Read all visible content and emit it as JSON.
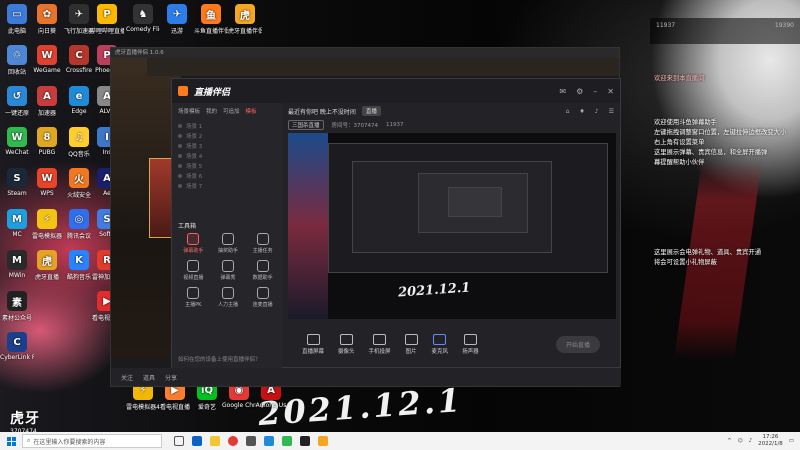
{
  "desktop": {
    "icons": [
      {
        "label": "此电脑",
        "color": "#3d7bd8",
        "glyph": "▭"
      },
      {
        "label": "向日葵",
        "color": "#e8742a",
        "glyph": "✿"
      },
      {
        "label": "飞行加速器",
        "color": "#2f2f2f",
        "glyph": "✈"
      },
      {
        "label": "哔哩哔哩直播",
        "color": "#ffb800",
        "glyph": "P"
      },
      {
        "label": "Comedy Flight",
        "color": "#333",
        "glyph": "♞"
      },
      {
        "label": "迅游",
        "color": "#2b7de9",
        "glyph": "✈"
      },
      {
        "label": "斗鱼直播伴侣",
        "color": "#ff7a1a",
        "glyph": "鱼"
      },
      {
        "label": "虎牙直播伴侣",
        "color": "#f5a623",
        "glyph": "虎"
      },
      {
        "label": "回收站",
        "color": "#4c88d6",
        "glyph": "♲"
      },
      {
        "label": "WeGame",
        "color": "#e0402f",
        "glyph": "W"
      },
      {
        "label": "Crossfire",
        "color": "#b5362b",
        "glyph": "C"
      },
      {
        "label": "Phoenix",
        "color": "#bb3f5a",
        "glyph": "P"
      },
      {
        "label": "一键还原",
        "color": "#2a89d6",
        "glyph": "↺"
      },
      {
        "label": "加速器",
        "color": "#c63d3d",
        "glyph": "A"
      },
      {
        "label": "Edge",
        "color": "#1f8bd8",
        "glyph": "e"
      },
      {
        "label": "ALVR",
        "color": "#888",
        "glyph": "A"
      },
      {
        "label": "WeChat",
        "color": "#2fb94f",
        "glyph": "W"
      },
      {
        "label": "Ins",
        "color": "#3f77c8",
        "glyph": "I"
      },
      {
        "label": "Steam",
        "color": "#1b2838",
        "glyph": "S"
      },
      {
        "label": "PUBG",
        "color": "#e0a820",
        "glyph": "8"
      },
      {
        "label": "QQ音乐",
        "color": "#ffce2e",
        "glyph": "♫"
      },
      {
        "label": "Ae",
        "color": "#1a1e6e",
        "glyph": "A"
      },
      {
        "label": "MC",
        "color": "#1ea0e0",
        "glyph": "M"
      },
      {
        "label": "WPS",
        "color": "#e8442a",
        "glyph": "W"
      },
      {
        "label": "火绒安全",
        "color": "#f07820",
        "glyph": "火"
      },
      {
        "label": "MWin",
        "color": "#2a2a2a",
        "glyph": "M"
      },
      {
        "label": "SoftE",
        "color": "#3f7de0",
        "glyph": "S"
      },
      {
        "label": "素材公众号",
        "color": "#222",
        "glyph": "素"
      },
      {
        "label": "雷电模拟器",
        "color": "#f3c413",
        "glyph": "⚡"
      },
      {
        "label": "腾讯会议",
        "color": "#2f6fed",
        "glyph": "◎"
      },
      {
        "label": "雷神加速器",
        "color": "#e03b2c",
        "glyph": "R"
      },
      {
        "label": "雷电模拟器4",
        "color": "#f2b705",
        "glyph": "⚡"
      },
      {
        "label": "CyberLink PowerDirector",
        "color": "#1b3f8c",
        "glyph": "C"
      },
      {
        "label": "虎牙直播",
        "color": "#e5a224",
        "glyph": "虎"
      },
      {
        "label": "酷狗音乐",
        "color": "#2684ff",
        "glyph": "K"
      },
      {
        "label": "看电视大师",
        "color": "#e22b2b",
        "glyph": "▶"
      },
      {
        "label": "看电视直播",
        "color": "#ff7e2e",
        "glyph": "▶"
      },
      {
        "label": "爱奇艺",
        "color": "#00c21f",
        "glyph": "iQ"
      },
      {
        "label": "Google Chrome",
        "color": "#e53935",
        "glyph": "◉"
      },
      {
        "label": "Among Us",
        "color": "#c51111",
        "glyph": "A"
      }
    ],
    "wallpaper_date": "2021.12.1",
    "huya_logo": "虎牙",
    "huya_room": "3707474"
  },
  "right_panel": {
    "left_count": "11937",
    "right_count": "19390",
    "welcome": "欢迎来到本直播间",
    "messages": [
      "欢迎使用斗鱼弹幕助手",
      "左键拖拽调整窗口位置，左键拉伸边框改变大小",
      "右上角有设置菜单",
      "这里展示弹幕、贵宾信息，和全屏开播弹",
      "幕提醒帮助小伙伴",
      "这里展示会电弹礼物、道具、贵宾开通",
      "将会可设置小礼物屏蔽"
    ]
  },
  "app": {
    "outer_title": "虎牙直播伴侣 1.0.6",
    "brand": "直播伴侣",
    "side_tabs": [
      "场景模板",
      "我的",
      "可追加",
      "模板"
    ],
    "scenes": [
      "场景 1",
      "场景 2",
      "场景 3",
      "场景 4",
      "场景 5",
      "场景 6",
      "场景 7"
    ],
    "tools_title": "工具箱",
    "tools": [
      {
        "label": "弹幕助手",
        "red": true
      },
      {
        "label": "抽奖助手",
        "red": false
      },
      {
        "label": "主播任务",
        "red": false
      },
      {
        "label": "视频直播",
        "red": false
      },
      {
        "label": "弹幕秀",
        "red": false
      },
      {
        "label": "数据助手",
        "red": false
      },
      {
        "label": "主播PK",
        "red": false
      },
      {
        "label": "人力主播",
        "red": false
      },
      {
        "label": "连麦直播",
        "red": false
      }
    ],
    "side_bottom": "如何在您的设备上使用直播伴侣？",
    "room_title": "最近有你吧 晚上不没时间",
    "room_tag": "直播",
    "room_sub_btn": "三国杀直播",
    "room_id": "房间号：3707474",
    "fans": "11937",
    "bottom_tools": [
      "直播屏幕",
      "摄像头",
      "手机投屏",
      "图片",
      "麦克风",
      "扬声器"
    ],
    "start_live": "开始直播",
    "outer_bottom": [
      "关注",
      "道具",
      "分享"
    ]
  },
  "taskbar": {
    "search_placeholder": "在这里输入你要搜索的内容",
    "time": "17:26",
    "date": "2022/1/8"
  }
}
